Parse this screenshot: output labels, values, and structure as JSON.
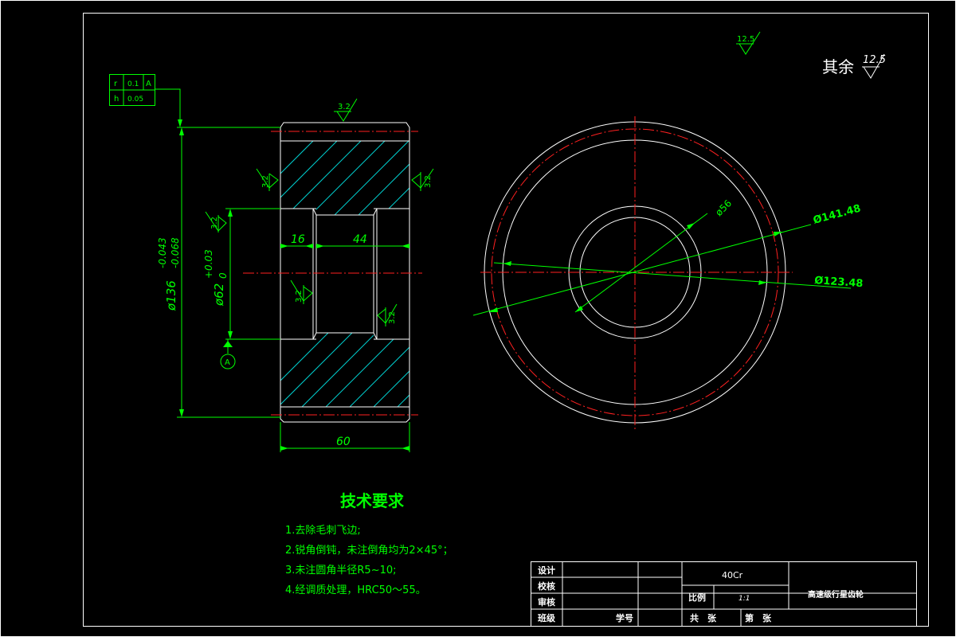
{
  "other_roughness": {
    "label": "其余",
    "value": "12.5"
  },
  "top_roughness": "12.5",
  "tolerance_frame": {
    "rows": [
      {
        "symbol": "r",
        "value": "0.1",
        "datum": "A"
      },
      {
        "symbol": "h",
        "value": "0.05",
        "datum": ""
      }
    ]
  },
  "datum_label": "A",
  "section_roughness": {
    "top": "3.2",
    "left_outer": "3.2",
    "right_outer": "3.2",
    "bore_left": "3.2",
    "bore_inner": "3.2",
    "bore_right": "3.2"
  },
  "dimensions": {
    "outer_dia": "ø136",
    "outer_dia_tol_upper": "-0.043",
    "outer_dia_tol_lower": "-0.068",
    "bore_dia": "ø62",
    "bore_dia_tol_upper": "+0.03",
    "bore_dia_tol_lower": "0",
    "recess_len": "16",
    "bore_len": "44",
    "width": "60",
    "d56": "ø56",
    "d141": "Ø141.48",
    "d123": "Ø123.48"
  },
  "tech_requirements": {
    "title": "技术要求",
    "items": [
      "1.去除毛刺飞边;",
      "2.锐角倒钝，未注倒角均为2×45°；",
      "3.未注圆角半径R5~10;",
      "4.经调质处理，HRC50～55。"
    ]
  },
  "title_block": {
    "labels": [
      "设计",
      "校核",
      "审核",
      "班级"
    ],
    "student_no": "学号",
    "material": "40Cr",
    "scale_label": "比例",
    "scale_value": "1:1",
    "part_name": "高速级行星齿轮",
    "sheet_total": "共　张",
    "sheet_num": "第　张"
  }
}
